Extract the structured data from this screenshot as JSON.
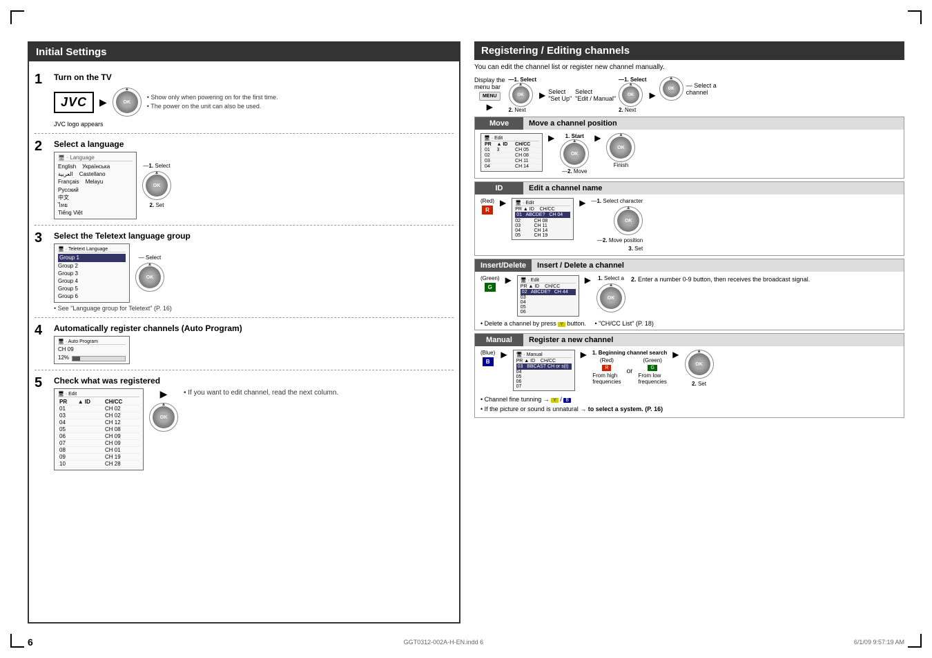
{
  "page": {
    "number": "6",
    "file_info": "GGT0312-002A-H-EN.indd   6",
    "timestamp": "6/1/09   9:57:19 AM"
  },
  "left_section": {
    "title": "Initial Settings",
    "steps": [
      {
        "number": "1",
        "title": "Turn on the TV",
        "notes": [
          "Show only when powering on for the first time.",
          "The power on the unit can also be used."
        ],
        "sub_label": "JVC logo appears"
      },
      {
        "number": "2",
        "title": "Select a language",
        "diagram_label": "1. Select",
        "set_label": "2. Set",
        "languages": [
          "English",
          "Українська",
          "العربية",
          "Castellano",
          "Français",
          "Melayu",
          "Русский",
          "中文",
          "ไทย",
          "Tiếng Việt"
        ]
      },
      {
        "number": "3",
        "title": "Select the Teletext language group",
        "select_label": "Select",
        "groups": [
          "Group 1",
          "Group 2",
          "Group 3",
          "Group 4",
          "Group 5",
          "Group 6"
        ],
        "note": "See \"Language group for Teletext\" (P. 16)"
      },
      {
        "number": "4",
        "title": "Automatically register channels (Auto Program)",
        "ch_label": "CH 09",
        "progress": "12%"
      },
      {
        "number": "5",
        "title": "Check what was registered",
        "note": "If you want to edit channel, read the next column.",
        "channels": [
          {
            "pr": "01",
            "id": "",
            "chcc": "CH 02"
          },
          {
            "pr": "03",
            "id": "",
            "chcc": "CH 02"
          },
          {
            "pr": "04",
            "id": "",
            "chcc": "CH 12"
          },
          {
            "pr": "05",
            "id": "",
            "chcc": "CH 08"
          },
          {
            "pr": "06",
            "id": "",
            "chcc": "CH 09"
          },
          {
            "pr": "07",
            "id": "",
            "chcc": "CH 09"
          },
          {
            "pr": "08",
            "id": "",
            "chcc": "CH 01"
          },
          {
            "pr": "09",
            "id": "",
            "chcc": "CH 19"
          },
          {
            "pr": "10",
            "id": "",
            "chcc": "CH 28"
          }
        ]
      }
    ]
  },
  "right_section": {
    "title": "Registering / Editing channels",
    "intro": "You can edit the channel list or register new channel manually.",
    "nav_steps": [
      {
        "label": "Display the menu bar"
      },
      {
        "label": "Select \"Set Up\""
      },
      {
        "label": "Select \"Edit / Manual\""
      },
      {
        "label": "Select a channel"
      }
    ],
    "sub_sections": [
      {
        "id": "move",
        "label": "Move",
        "title": "Move a channel position",
        "step1": "1. Start",
        "step2": "2. Move",
        "finish": "Finish"
      },
      {
        "id": "id",
        "label": "ID",
        "title": "Edit a channel name",
        "step1": "1. Select character",
        "step2": "2. Move position",
        "step3": "3. Set",
        "red_label": "(Red)"
      },
      {
        "id": "insert_delete",
        "label": "Insert/Delete",
        "title": "Insert / Delete a channel",
        "step1": "1. Select a",
        "step2": "2. Enter a number 0-9 button, then receives the broadcast signal.",
        "ch_cc_label": "CH/CC",
        "note1": "Delete a channel by press (Yellow) button.",
        "note2": "\"CH/CC List\" (P. 18)",
        "green_label": "(Green)"
      },
      {
        "id": "manual",
        "label": "Manual",
        "title": "Register a new channel",
        "step1": "1. Beginning channel search",
        "step2": "2. Set",
        "red_label": "(Red)",
        "green_label": "(Green)",
        "blue_label": "(Blue)",
        "freq_high": "From high frequencies",
        "freq_low": "From low frequencies",
        "note1": "Channel fine tunning → (Yellow) / (Blue)",
        "note2": "If the picture or sound is unnatural → to select a system. (P. 16)"
      }
    ]
  }
}
